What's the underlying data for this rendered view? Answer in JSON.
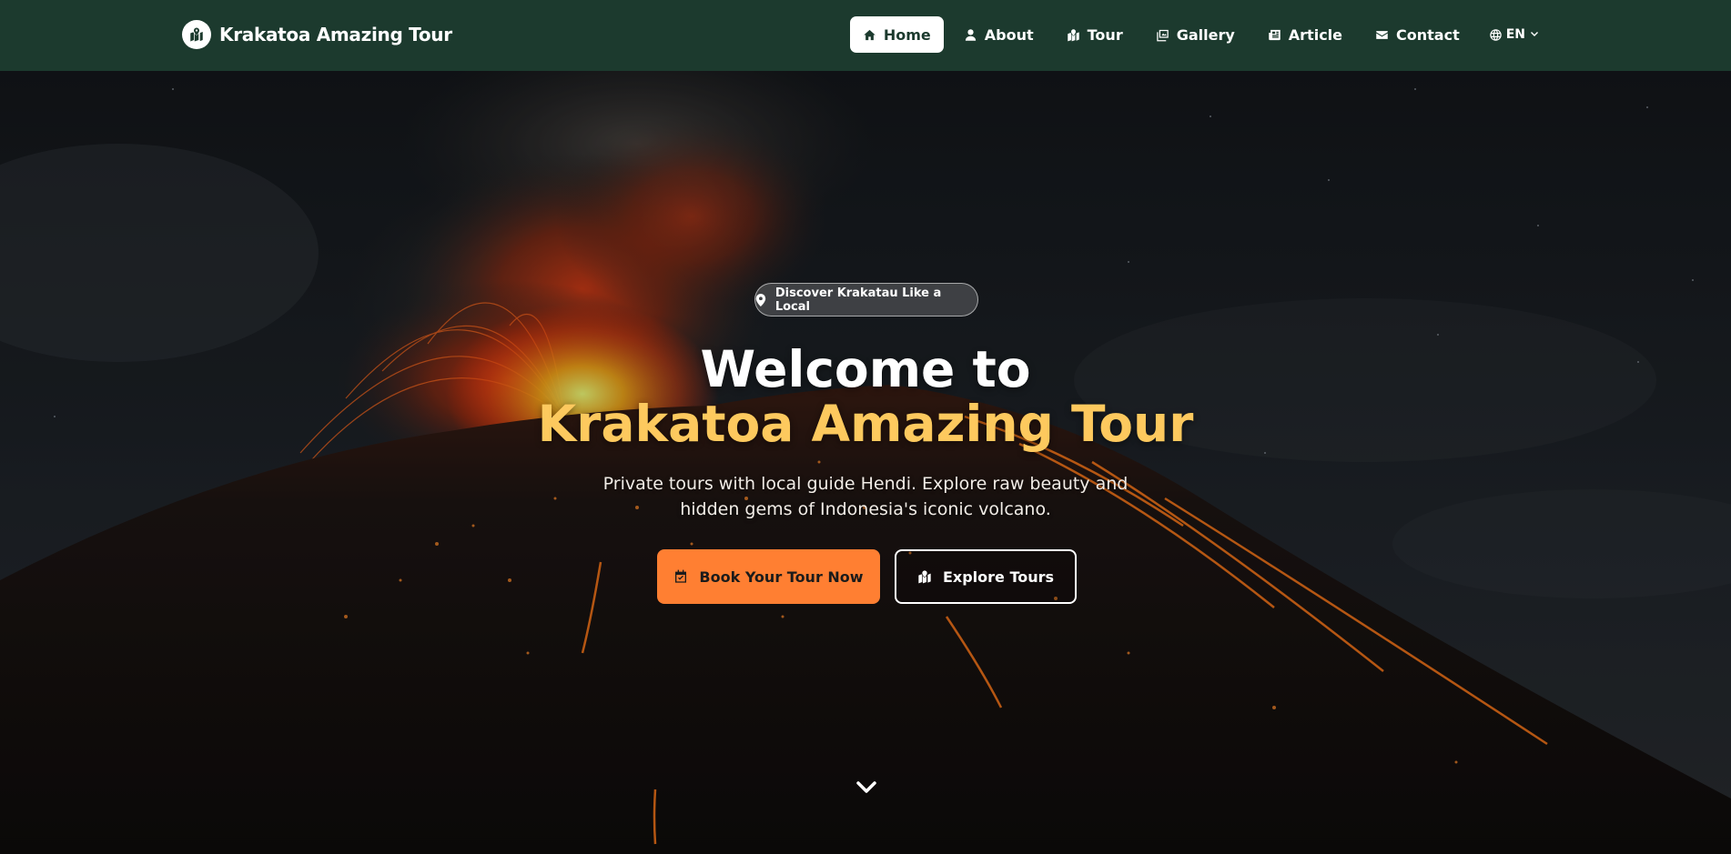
{
  "brand": {
    "name": "Krakatoa Amazing Tour",
    "logo_icon": "map-location-icon"
  },
  "nav": {
    "items": [
      {
        "label": "Home",
        "icon": "home-icon",
        "active": true
      },
      {
        "label": "About",
        "icon": "user-icon",
        "active": false
      },
      {
        "label": "Tour",
        "icon": "map-icon",
        "active": false
      },
      {
        "label": "Gallery",
        "icon": "images-icon",
        "active": false
      },
      {
        "label": "Article",
        "icon": "newspaper-icon",
        "active": false
      },
      {
        "label": "Contact",
        "icon": "envelope-icon",
        "active": false
      }
    ],
    "language": {
      "label": "EN",
      "icon": "globe-icon"
    }
  },
  "hero": {
    "badge": "Discover Krakatau Like a Local",
    "title_line1": "Welcome to",
    "title_line2": "Krakatoa Amazing Tour",
    "subtitle": "Private tours with local guide Hendi. Explore raw beauty and hidden gems of Indonesia's iconic volcano.",
    "primary_button": "Book Your Tour Now",
    "secondary_button": "Explore Tours",
    "scroll_icon": "chevron-down-icon"
  },
  "colors": {
    "navbar": "#1c3a2e",
    "accent_gold": "#fdc95e",
    "accent_orange": "#ff7f32",
    "active_nav_bg": "#ffffff"
  }
}
